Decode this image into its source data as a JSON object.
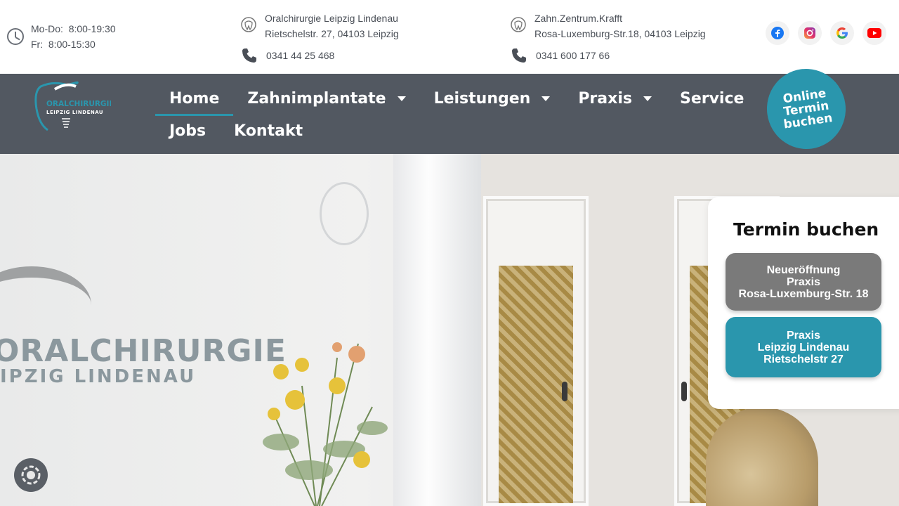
{
  "topbar": {
    "hours": {
      "line1_day": "Mo-Do:",
      "line1_time": "8:00-19:30",
      "line2_day": "Fr:",
      "line2_time": "8:00-15:30"
    },
    "location1": {
      "name": "Oralchirurgie Leipzig Lindenau",
      "address": "Rietschelstr. 27, 04103 Leipzig",
      "phone": "0341 44 25 468"
    },
    "location2": {
      "name": "Zahn.Zentrum.Krafft",
      "address": "Rosa-Luxemburg-Str.18, 04103 Leipzig",
      "phone": "0341 600 177 66"
    },
    "social": [
      "facebook-icon",
      "instagram-icon",
      "google-icon",
      "youtube-icon"
    ]
  },
  "nav": {
    "logo_text1": "ORALCHIRURGIE",
    "logo_text2": "LEIPZIG LINDENAU",
    "items": [
      {
        "label": "Home",
        "active": true,
        "dropdown": false
      },
      {
        "label": "Zahnimplantate",
        "active": false,
        "dropdown": true
      },
      {
        "label": "Leistungen",
        "active": false,
        "dropdown": true
      },
      {
        "label": "Praxis",
        "active": false,
        "dropdown": true
      },
      {
        "label": "Service",
        "active": false,
        "dropdown": false
      },
      {
        "label": "Jobs",
        "active": false,
        "dropdown": false
      },
      {
        "label": "Kontakt",
        "active": false,
        "dropdown": false
      }
    ],
    "cta": {
      "line1": "Online",
      "line2": "Termin",
      "line3": "buchen"
    }
  },
  "hero": {
    "sign_line1": "ORALCHIRURGIE",
    "sign_line2": "IPZIG LINDENAU"
  },
  "booking": {
    "title": "Termin buchen",
    "btn1": {
      "line1": "Neueröffnung",
      "line2": "Praxis",
      "line3": "Rosa-Luxemburg-Str. 18"
    },
    "btn2": {
      "line1": "Praxis",
      "line2": "Leipzig Lindenau",
      "line3": "Rietschelstr 27"
    }
  },
  "colors": {
    "accent": "#2a96ad",
    "nav_bg": "#525861",
    "gray_btn": "#7a7a7a"
  }
}
